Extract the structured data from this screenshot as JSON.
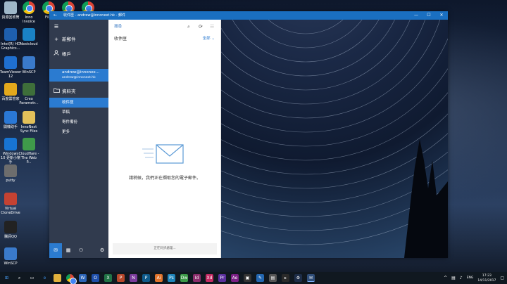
{
  "desktop": {
    "icons": [
      {
        "label": "資源回收筒",
        "color": "#9fb7c9"
      },
      {
        "label": "Inno Invoice",
        "color": "chrome"
      },
      {
        "label": "Fil...",
        "color": "chrome"
      },
      {
        "label": "",
        "color": "chrome"
      },
      {
        "label": "",
        "color": "chrome"
      },
      {
        "label": "Intel(R) HD Graphics...",
        "color": "#1e5fae"
      },
      {
        "label": "Nextcloud",
        "color": "#1a82c5"
      },
      {
        "label": "TeamViewer 12",
        "color": "#1f6fd0"
      },
      {
        "label": "WinSCP",
        "color": "#3a7acb"
      },
      {
        "label": "百度雲管家",
        "color": "#e3a91c"
      },
      {
        "label": "Creo Parametr...",
        "color": "#3e6f3a"
      },
      {
        "label": "開機助手",
        "color": "#2a78d6"
      },
      {
        "label": "InnoNext Sync Files",
        "color": "#e2c05a"
      },
      {
        "label": "Windows 10 更新小幫手",
        "color": "#1874d2"
      },
      {
        "label": "Cloudflare - The Web P...",
        "color": "#3f9a4a"
      },
      {
        "label": "putty",
        "color": "#6d6d6d"
      },
      {
        "label": "Virtual CloneDrive",
        "color": "#c44232"
      },
      {
        "label": "騰訊QQ",
        "color": "#222"
      },
      {
        "label": "WinSCP",
        "color": "#3a7acb"
      }
    ]
  },
  "window": {
    "title": "收件匣 - andrew@innonext.hk - 郵件",
    "back_symbol": "←",
    "minimize_symbol": "—",
    "maximize_symbol": "☐",
    "close_symbol": "✕",
    "titlebar_color": "#1a6fc1"
  },
  "sidebar": {
    "menu_symbol": "☰",
    "new_mail_label": "新郵件",
    "new_mail_symbol": "+",
    "accounts_label": "帳戶",
    "account_name": "andrew@innonex...",
    "account_email": "andrew@innonext.hk",
    "folders_label": "資料夾",
    "folders": [
      {
        "label": "收件匣",
        "active": true
      },
      {
        "label": "草稿",
        "active": false
      },
      {
        "label": "寄件備份",
        "active": false
      },
      {
        "label": "更多",
        "active": false
      }
    ],
    "accent": "#2b7bd0"
  },
  "list": {
    "search_label": "搜尋",
    "folder_title": "收件匣",
    "filter_label": "全部",
    "empty_message": "請稍候，我們正在擷取您的電子郵件。",
    "footer_text": "正在同步處理..."
  },
  "taskbar": {
    "time": "17:23",
    "date": "14/11/2017",
    "language": "ENG"
  }
}
